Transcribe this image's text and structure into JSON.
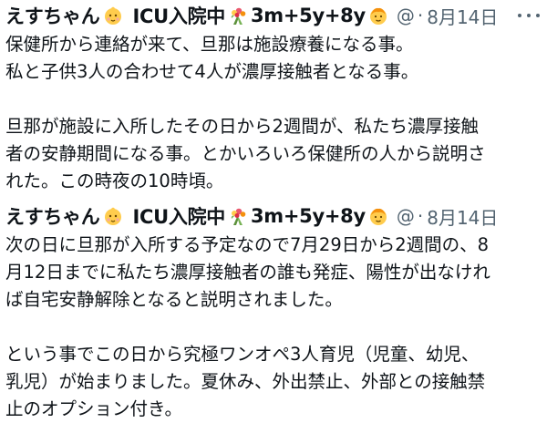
{
  "tweets": [
    {
      "author": {
        "name_part1": "えすちゃん",
        "name_part2": "ICU入院中",
        "name_part3": "3m+5y+8y"
      },
      "handle_sep": "@",
      "dot": "·",
      "date": "8月14日",
      "lines": [
        "保健所から連絡が来て、旦那は施設療養になる事。",
        "私と子供3人の合わせて4人が濃厚接触者となる事。",
        "",
        "旦那が施設に入所したその日から2週間が、私たち濃厚接触",
        "者の安静期間になる事。とかいろいろ保健所の人から説明さ",
        "れた。この時夜の10時頃。"
      ]
    },
    {
      "author": {
        "name_part1": "えすちゃん",
        "name_part2": "ICU入院中",
        "name_part3": "3m+5y+8y"
      },
      "handle_sep": "@",
      "dot": "·",
      "date": "8月14日",
      "lines": [
        "次の日に旦那が入所する予定なので7月29日から2週間の、8",
        "月12日までに私たち濃厚接触者の誰も発症、陽性が出なけれ",
        "ば自宅安静解除となると説明されました。",
        "",
        "という事でこの日から究極ワンオペ3人育児（児童、幼児、",
        "乳児）が始まりました。夏休み、外出禁止、外部との接触禁",
        "止のオプション付き。"
      ]
    }
  ],
  "icons": {
    "baby": "baby-face-icon",
    "flower": "bouquet-icon",
    "child": "child-face-icon",
    "more": "more-icon"
  }
}
